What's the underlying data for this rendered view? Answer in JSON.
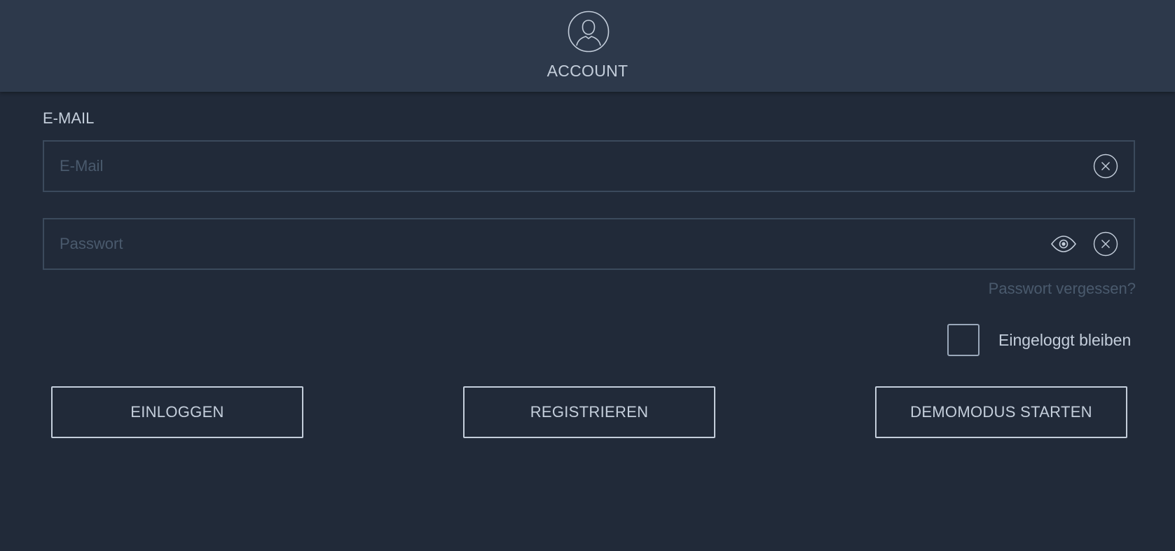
{
  "header": {
    "title": "ACCOUNT",
    "avatar_icon": "user-circle-icon"
  },
  "form": {
    "email_label": "E-MAIL",
    "email_placeholder": "E-Mail",
    "email_value": "",
    "password_placeholder": "Passwort",
    "password_value": "",
    "forgot_password": "Passwort vergessen?",
    "stay_logged_in": "Eingeloggt bleiben",
    "stay_logged_in_checked": false
  },
  "buttons": {
    "login": "EINLOGGEN",
    "register": "REGISTRIEREN",
    "demo": "DEMOMODUS STARTEN"
  },
  "icons": {
    "clear": "close-circle-icon",
    "show_password": "eye-icon"
  },
  "colors": {
    "background": "#212a39",
    "header": "#2d394b",
    "text": "#c4cedb",
    "muted": "#4a5a6d",
    "border": "#3b4a5c"
  }
}
